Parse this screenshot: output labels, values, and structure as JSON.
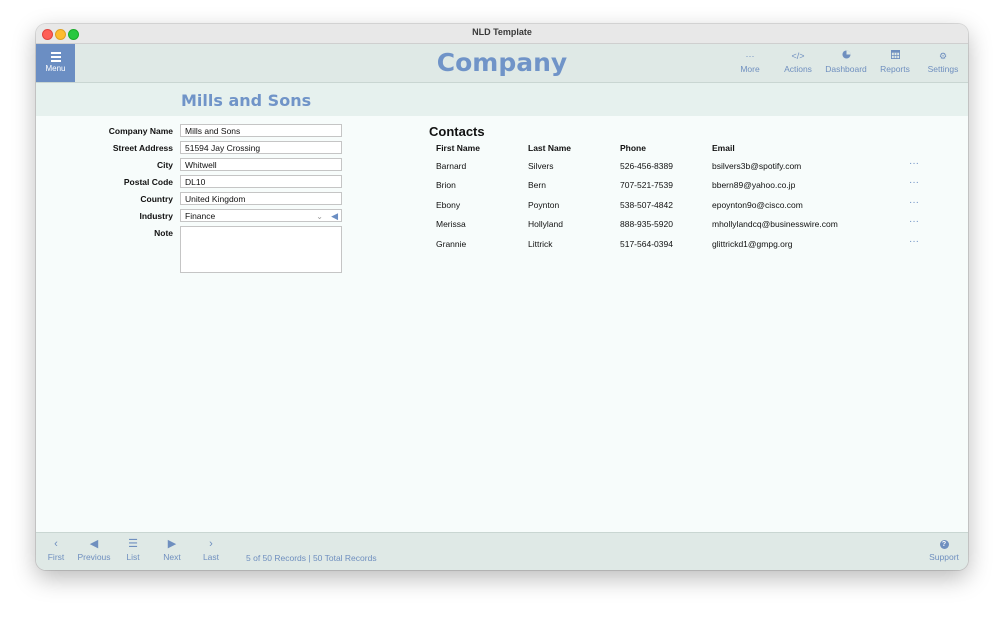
{
  "window": {
    "title": "NLD Template"
  },
  "header": {
    "menu_label": "Menu",
    "title": "Company",
    "tools": [
      {
        "label": "More",
        "icon": "ellipsis-icon"
      },
      {
        "label": "Actions",
        "icon": "code-icon"
      },
      {
        "label": "Dashboard",
        "icon": "pie-chart-icon"
      },
      {
        "label": "Reports",
        "icon": "calendar-icon"
      },
      {
        "label": "Settings",
        "icon": "gear-icon"
      }
    ]
  },
  "record": {
    "title": "Mills and Sons"
  },
  "form": {
    "company_name": {
      "label": "Company Name",
      "value": "Mills and Sons"
    },
    "street_address": {
      "label": "Street Address",
      "value": "51594 Jay Crossing"
    },
    "city": {
      "label": "City",
      "value": "Whitwell"
    },
    "postal_code": {
      "label": "Postal Code",
      "value": "DL10"
    },
    "country": {
      "label": "Country",
      "value": "United Kingdom"
    },
    "industry": {
      "label": "Industry",
      "value": "Finance"
    },
    "note": {
      "label": "Note",
      "value": ""
    }
  },
  "contacts": {
    "title": "Contacts",
    "columns": [
      "First Name",
      "Last Name",
      "Phone",
      "Email"
    ],
    "rows": [
      {
        "first": "Barnard",
        "last": "Silvers",
        "phone": "526-456-8389",
        "email": "bsilvers3b@spotify.com",
        "more": "···"
      },
      {
        "first": "Brion",
        "last": "Bern",
        "phone": "707-521-7539",
        "email": "bbern89@yahoo.co.jp",
        "more": "···"
      },
      {
        "first": "Ebony",
        "last": "Poynton",
        "phone": "538-507-4842",
        "email": "epoynton9o@cisco.com",
        "more": "···"
      },
      {
        "first": "Merissa",
        "last": "Hollyland",
        "phone": "888-935-5920",
        "email": "mhollylandcq@businesswire.com",
        "more": "···"
      },
      {
        "first": "Grannie",
        "last": "Littrick",
        "phone": "517-564-0394",
        "email": "glittrickd1@gmpg.org",
        "more": "···"
      }
    ]
  },
  "footer": {
    "nav": [
      {
        "label": "First",
        "icon": "chevron-left-icon"
      },
      {
        "label": "Previous",
        "icon": "triangle-left-icon"
      },
      {
        "label": "List",
        "icon": "list-icon"
      },
      {
        "label": "Next",
        "icon": "triangle-right-icon"
      },
      {
        "label": "Last",
        "icon": "chevron-right-icon"
      }
    ],
    "status": "5 of 50 Records | 50 Total Records",
    "support_label": "Support"
  },
  "colors": {
    "accent": "#6b8ec3",
    "header_bg": "#dfe9e6",
    "content_bg": "#f7fcfb"
  }
}
